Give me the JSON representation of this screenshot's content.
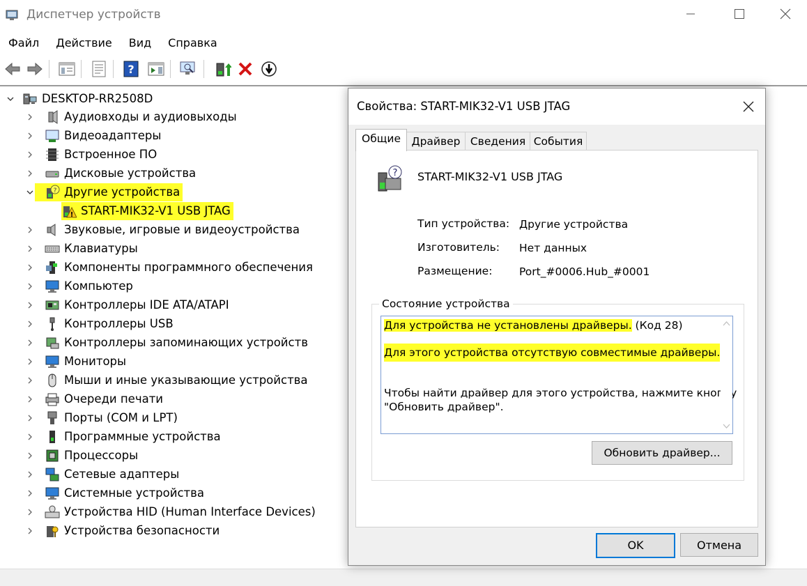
{
  "window": {
    "title": "Диспетчер устройств",
    "icons": [
      "device-manager-icon",
      "minimize-icon",
      "maximize-icon",
      "close-icon"
    ]
  },
  "menu": [
    "Файл",
    "Действие",
    "Вид",
    "Справка"
  ],
  "toolbar": {
    "buttons": [
      "back-icon",
      "forward-icon",
      "show-hide-tree-icon",
      "properties-icon",
      "help-icon",
      "action-pane-icon",
      "scan-hardware-icon",
      "update-driver-icon",
      "uninstall-icon",
      "disable-icon"
    ]
  },
  "tree": {
    "root": "DESKTOP-RR2508D",
    "items": [
      {
        "label": "Аудиовходы и аудиовыходы",
        "icon": "audio-io-icon"
      },
      {
        "label": "Видеоадаптеры",
        "icon": "display-adapter-icon"
      },
      {
        "label": "Встроенное ПО",
        "icon": "firmware-icon"
      },
      {
        "label": "Дисковые устройства",
        "icon": "disk-drive-icon"
      },
      {
        "label": "Другие устройства",
        "icon": "other-devices-icon",
        "expanded": true,
        "highlighted": true
      },
      {
        "label": "START-MIK32-V1 USB JTAG",
        "icon": "warning-device-icon",
        "child": true,
        "highlighted": true
      },
      {
        "label": "Звуковые, игровые и видеоустройства",
        "icon": "sound-icon"
      },
      {
        "label": "Клавиатуры",
        "icon": "keyboard-icon"
      },
      {
        "label": "Компоненты программного обеспечения",
        "icon": "software-component-icon"
      },
      {
        "label": "Компьютер",
        "icon": "computer-icon"
      },
      {
        "label": "Контроллеры IDE ATA/ATAPI",
        "icon": "ide-controller-icon"
      },
      {
        "label": "Контроллеры USB",
        "icon": "usb-controller-icon"
      },
      {
        "label": "Контроллеры запоминающих устройств",
        "icon": "storage-controller-icon"
      },
      {
        "label": "Мониторы",
        "icon": "monitor-icon"
      },
      {
        "label": "Мыши и иные указывающие устройства",
        "icon": "mouse-icon"
      },
      {
        "label": "Очереди печати",
        "icon": "print-queue-icon"
      },
      {
        "label": "Порты (COM и LPT)",
        "icon": "ports-icon"
      },
      {
        "label": "Программные устройства",
        "icon": "software-device-icon"
      },
      {
        "label": "Процессоры",
        "icon": "processor-icon"
      },
      {
        "label": "Сетевые адаптеры",
        "icon": "network-adapter-icon"
      },
      {
        "label": "Системные устройства",
        "icon": "system-device-icon"
      },
      {
        "label": "Устройства HID (Human Interface Devices)",
        "icon": "hid-icon"
      },
      {
        "label": "Устройства безопасности",
        "icon": "security-device-icon"
      }
    ]
  },
  "dialog": {
    "title": "Свойства: START-MIK32-V1 USB JTAG",
    "tabs": [
      "Общие",
      "Драйвер",
      "Сведения",
      "События"
    ],
    "active_tab": "Общие",
    "device_name": "START-MIK32-V1 USB JTAG",
    "properties": [
      {
        "label": "Тип устройства:",
        "value": "Другие устройства"
      },
      {
        "label": "Изготовитель:",
        "value": "Нет данных"
      },
      {
        "label": "Размещение:",
        "value": "Port_#0006.Hub_#0001"
      }
    ],
    "status_group": "Состояние устройства",
    "status": {
      "line1_highlight": "Для устройства не установлены драйверы.",
      "line1_rest": " (Код 28)",
      "line2_highlight": "Для этого устройства отсутствую совместимые драйверы.",
      "line3": "Чтобы найти драйвер для этого устройства, нажмите кнопку",
      "line4": "\"Обновить драйвер\"."
    },
    "update_button": "Обновить драйвер...",
    "ok_button": "OK",
    "cancel_button": "Отмена",
    "highlight_color": "#ffff2b",
    "focus_color": "#0078d7"
  }
}
